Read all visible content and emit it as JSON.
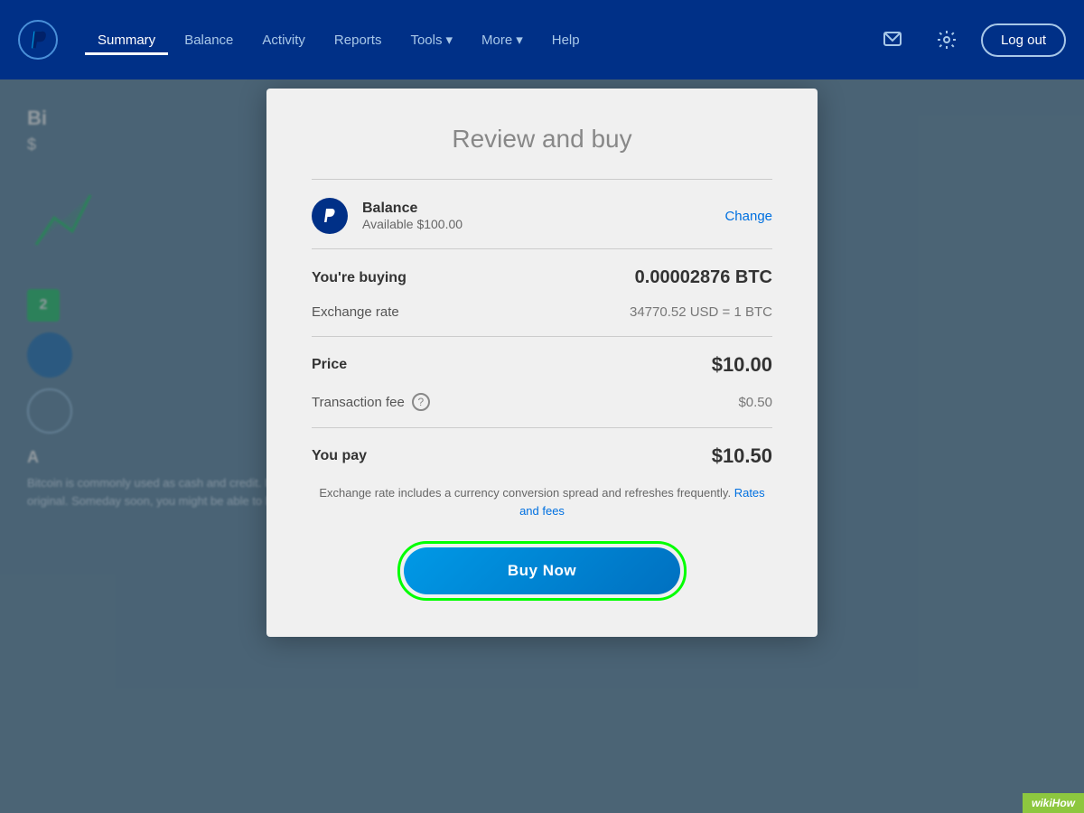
{
  "navbar": {
    "logo_alt": "PayPal",
    "nav_items": [
      {
        "label": "Summary",
        "active": true
      },
      {
        "label": "Balance",
        "active": false
      },
      {
        "label": "Activity",
        "active": false
      },
      {
        "label": "Reports",
        "active": false
      },
      {
        "label": "Tools",
        "active": false,
        "has_dropdown": true
      },
      {
        "label": "More",
        "active": false,
        "has_dropdown": true
      },
      {
        "label": "Help",
        "active": false
      }
    ],
    "logout_label": "Log out"
  },
  "bg": {
    "title": "Bi",
    "subtitle": "$",
    "badge_num": "2",
    "body_heading": "A",
    "body_text": "Bitcoin is commonly used as cash and credit. It set off a revolution that has since inspired thousands of variations on the original. Someday soon, you might be able to buy just about anything and send money to anyone using bitcoins and other"
  },
  "modal": {
    "title": "Review and buy",
    "payment_method": {
      "label": "Balance",
      "available": "Available $100.00",
      "change_label": "Change"
    },
    "you_buying_label": "You're buying",
    "you_buying_value": "0.00002876 BTC",
    "exchange_rate_label": "Exchange rate",
    "exchange_rate_value": "34770.52 USD = 1 BTC",
    "price_label": "Price",
    "price_value": "$10.00",
    "transaction_fee_label": "Transaction fee",
    "transaction_fee_value": "$0.50",
    "you_pay_label": "You pay",
    "you_pay_value": "$10.50",
    "footer_note": "Exchange rate includes a currency conversion spread and refreshes frequently.",
    "rates_fees_label": "Rates and fees",
    "buy_now_label": "Buy Now"
  },
  "wikihow": {
    "label": "wikiHow"
  }
}
